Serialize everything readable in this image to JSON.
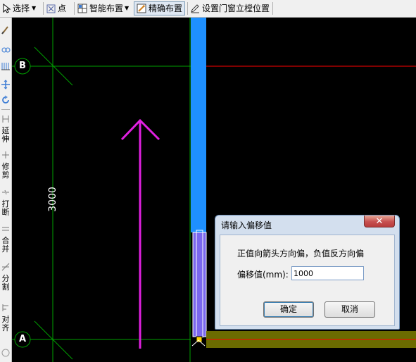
{
  "toolbar": {
    "select_label": "选择",
    "point_label": "点",
    "smart_layout_label": "智能布置",
    "precise_layout_label": "精确布置",
    "set_door_window_label": "设置门窗立樘位置"
  },
  "left_tools": [
    {
      "label": "延伸"
    },
    {
      "label": "修剪"
    },
    {
      "label": "打断"
    },
    {
      "label": "合并"
    },
    {
      "label": "分割"
    },
    {
      "label": "对齐"
    }
  ],
  "canvas": {
    "axis_b_label": "B",
    "axis_a_label": "A",
    "dimension_label": "3000",
    "colors": {
      "background": "#000000",
      "grid": "#00a000",
      "wall_blue": "#1e90ff",
      "arrow_magenta": "#e020e0",
      "red_line": "#ff0000"
    }
  },
  "dialog": {
    "title": "请输入偏移值",
    "message": "正值向箭头方向偏，负值反方向偏",
    "offset_label": "偏移值(mm):",
    "offset_value": "1000",
    "ok_label": "确定",
    "cancel_label": "取消"
  }
}
